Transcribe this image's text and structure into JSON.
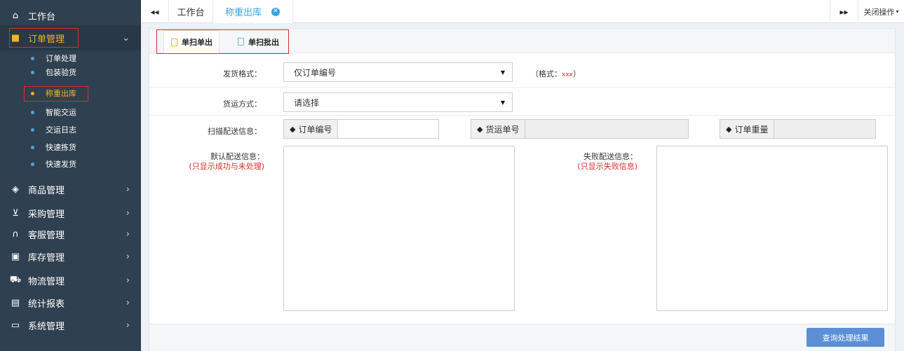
{
  "sidebar": {
    "items": [
      {
        "icon": "home-icon",
        "glyph": "⌂",
        "label": "工作台"
      },
      {
        "icon": "briefcase-icon",
        "glyph": "■",
        "label": "订单管理",
        "arrow": "⌄"
      },
      {
        "icon": "cube-icon",
        "glyph": "◈",
        "label": "商品管理",
        "arrow": "›"
      },
      {
        "icon": "cart-icon",
        "glyph": "⊻",
        "label": "采购管理",
        "arrow": "›"
      },
      {
        "icon": "headphones-icon",
        "glyph": "∩",
        "label": "客服管理",
        "arrow": "›"
      },
      {
        "icon": "inbox-icon",
        "glyph": "▣",
        "label": "库存管理",
        "arrow": "›"
      },
      {
        "icon": "truck-icon",
        "glyph": "⛟",
        "label": "物流管理",
        "arrow": "›"
      },
      {
        "icon": "document-icon",
        "glyph": "▤",
        "label": "统计报表",
        "arrow": "›"
      },
      {
        "icon": "desktop-icon",
        "glyph": "▭",
        "label": "系统管理",
        "arrow": "›"
      }
    ],
    "sub_items": [
      {
        "label": "订单处理"
      },
      {
        "label": "包装验货"
      },
      {
        "label": "称重出库"
      },
      {
        "label": "智能交运"
      },
      {
        "label": "交运日志"
      },
      {
        "label": "快速拣货"
      },
      {
        "label": "快速发货"
      }
    ]
  },
  "tabbar": {
    "back_glyph": "◂◂",
    "tabs": [
      {
        "label": "工作台"
      },
      {
        "label": "称重出库",
        "close_glyph": "✕"
      }
    ],
    "forward_glyph": "▸▸",
    "close_ops_label": "关闭操作",
    "close_ops_caret": "▾"
  },
  "panel": {
    "tabs": [
      {
        "label": "单扫单出"
      },
      {
        "label": "单扫批出"
      }
    ],
    "ship_format": {
      "label": "发货格式：",
      "value": "仅订单编号",
      "hint_prefix": "（格式：",
      "hint_example": "xxx",
      "hint_suffix": "）"
    },
    "ship_method": {
      "label": "货运方式：",
      "value": "请选择"
    },
    "scan": {
      "label": "扫描配送信息：",
      "order_no": "订单编号",
      "tracking_no": "货运单号",
      "order_weight": "订单重量"
    },
    "default_info": {
      "label": "默认配送信息：",
      "note": "(只显示成功与未处理)"
    },
    "failed_info": {
      "label": "失败配送信息：",
      "note": "(只显示失败信息)"
    },
    "query_button": "查询处理结果",
    "select_caret": "▼",
    "tag_glyph": "◆"
  }
}
